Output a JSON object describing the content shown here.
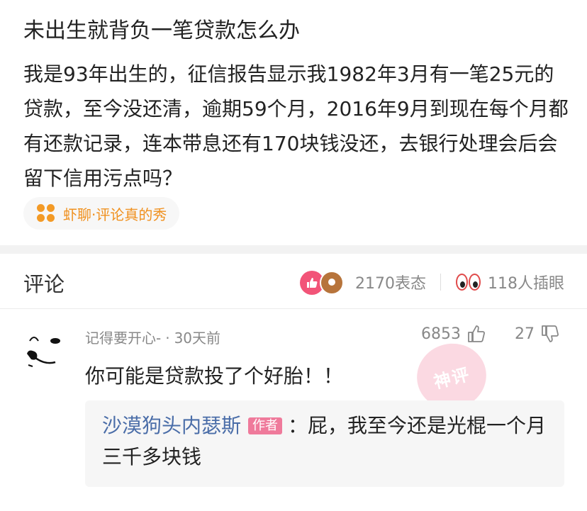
{
  "post": {
    "title": "未出生就背负一笔贷款怎么办",
    "body": "我是93年出生的，征信报告显示我1982年3月有一笔25元的贷款，至今没还清，逾期59个月，2016年9月到现在每个月都有还款记录，连本带息还有170块钱没还，去银行处理会后会留下信用污点吗？",
    "topic_label": "虾聊·评论真的秀"
  },
  "comments_header": {
    "title": "评论",
    "reaction_count": "2170表态",
    "insert_eye_count": "118人插眼"
  },
  "comment": {
    "username": "记得要开心-",
    "time": "30天前",
    "likes": "6853",
    "dislikes": "27",
    "text": "你可能是贷款投了个好胎！！",
    "stamp_text": "神评",
    "reply": {
      "author": "沙漠狗头内瑟斯",
      "badge": "作者",
      "separator": "：",
      "text": "屁，我至今还是光棍一个月三千多块钱"
    }
  },
  "colors": {
    "topic_orange": "#f0901e",
    "like_pink": "#f25478",
    "author_blue": "#4a6da8",
    "badge_pink": "#ef7a9b",
    "divider_gray": "#f2f2f2"
  }
}
